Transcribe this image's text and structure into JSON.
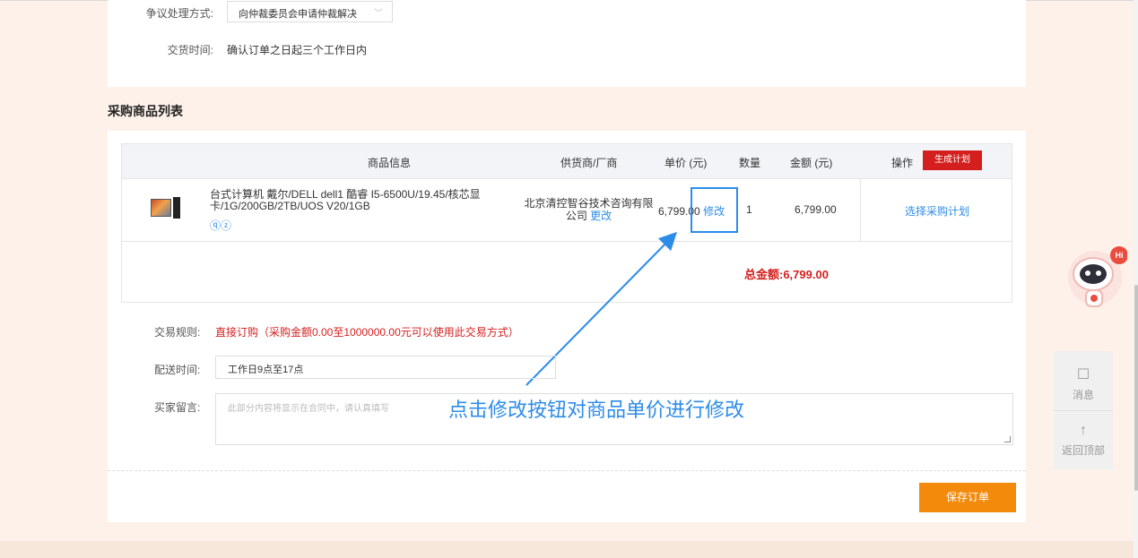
{
  "top": {
    "dispute_label": "争议处理方式:",
    "dispute_value": "向仲裁委员会申请仲裁解决",
    "delivery_label": "交货时间:",
    "delivery_value": "确认订单之日起三个工作日内"
  },
  "section_title": "采购商品列表",
  "table": {
    "headers": {
      "product": "商品信息",
      "supplier": "供货商/厂商",
      "unit_price": "单价 (元)",
      "quantity": "数量",
      "amount": "金额 (元)",
      "operation": "操作"
    },
    "generate_plan_label": "生成计划",
    "row": {
      "product_name": "台式计算机 戴尔/DELL dell1 酷睿 I5-6500U/19.45/核芯显卡/1G/200GB/2TB/UOS V20/1GB",
      "badges": "ⓠⓩ",
      "supplier": "北京清控智谷技术咨询有限公司",
      "supplier_change_label": "更改",
      "unit_price": "6,799.00",
      "modify_label": "修改",
      "quantity": "1",
      "amount": "6,799.00",
      "choose_plan_label": "选择采购计划"
    },
    "total_label": "总金额:6,799.00"
  },
  "form": {
    "trade_rule_label": "交易规则:",
    "trade_rule_value": "直接订购（采购金额0.00至1000000.00元可以使用此交易方式）",
    "delivery_time_label": "配送时间:",
    "delivery_time_value": "工作日9点至17点",
    "buyer_message_label": "买家留言:",
    "buyer_message_placeholder": "此部分内容将显示在合同中，请认真填写"
  },
  "annotation": "点击修改按钮对商品单价进行修改",
  "save_order_label": "保存订单",
  "side": {
    "message_label": "消息",
    "back_top_label": "返回顶部",
    "hi_badge": "Hi"
  },
  "colors": {
    "accent_blue": "#2d8ce8",
    "red": "#d51f1f",
    "orange": "#f38a0c",
    "page_bg": "#fdf1e9"
  }
}
